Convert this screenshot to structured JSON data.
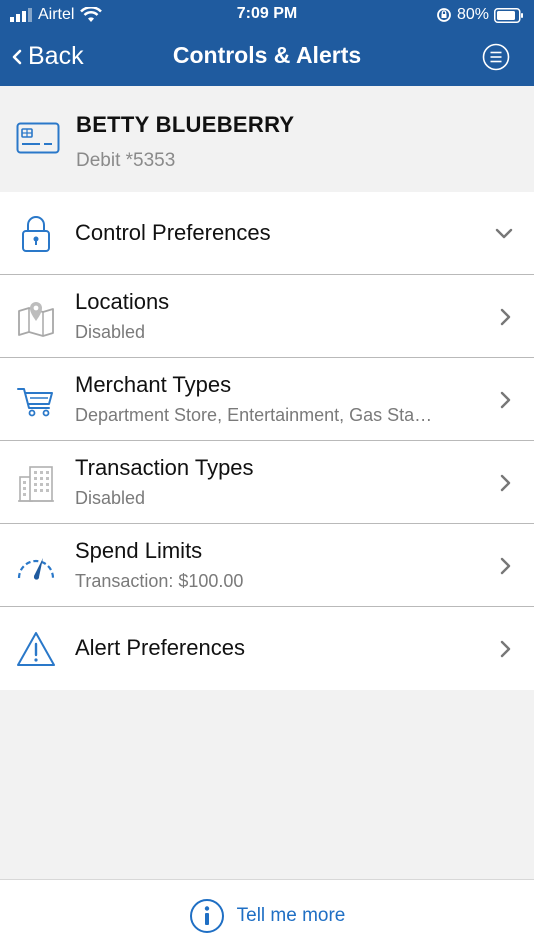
{
  "status_bar": {
    "carrier": "Airtel",
    "time": "7:09 PM",
    "battery": "80%"
  },
  "nav": {
    "back_label": "Back",
    "title": "Controls & Alerts"
  },
  "account": {
    "name": "BETTY BLUEBERRY",
    "card": "Debit *5353"
  },
  "rows": [
    {
      "title": "Control Preferences",
      "subtitle": "",
      "icon": "lock-icon",
      "chevron": "down"
    },
    {
      "title": "Locations",
      "subtitle": "Disabled",
      "icon": "map-pin-icon",
      "chevron": "right"
    },
    {
      "title": "Merchant Types",
      "subtitle": "Department Store, Entertainment, Gas Sta…",
      "icon": "cart-icon",
      "chevron": "right"
    },
    {
      "title": "Transaction Types",
      "subtitle": "Disabled",
      "icon": "buildings-icon",
      "chevron": "right"
    },
    {
      "title": "Spend Limits",
      "subtitle": "Transaction: $100.00",
      "icon": "gauge-icon",
      "chevron": "right"
    },
    {
      "title": "Alert Preferences",
      "subtitle": "",
      "icon": "warning-icon",
      "chevron": "right"
    }
  ],
  "footer": {
    "link_label": "Tell me more"
  },
  "colors": {
    "header_bg": "#1f5b9f",
    "accent": "#1f6fc4",
    "page_bg": "#f2f2f2"
  }
}
